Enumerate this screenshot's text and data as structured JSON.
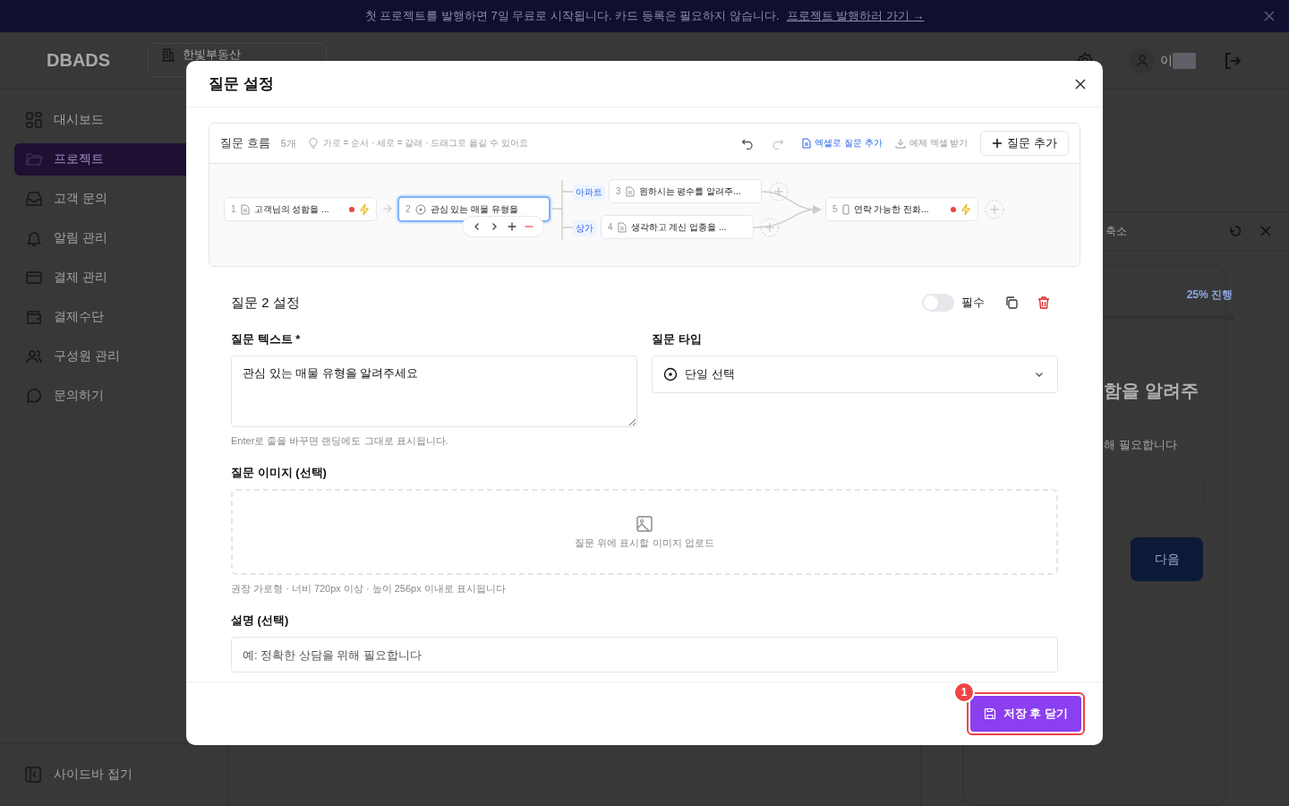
{
  "banner": {
    "text": "첫 프로젝트를 발행하면 7일 무료로 시작됩니다. 카드 등록은 필요하지 않습니다.",
    "link": "프로젝트 발행하러 가기 →"
  },
  "header": {
    "logo": "DBADS",
    "workspace": "한빛부동산",
    "user": "이"
  },
  "sidebar": {
    "items": [
      {
        "label": "대시보드",
        "selected": false
      },
      {
        "label": "프로젝트",
        "selected": true
      },
      {
        "label": "고객 문의",
        "selected": false
      },
      {
        "label": "알림 관리",
        "selected": false
      },
      {
        "label": "결제 관리",
        "selected": false
      },
      {
        "label": "결제수단",
        "selected": false
      },
      {
        "label": "구성원 관리",
        "selected": false
      },
      {
        "label": "문의하기",
        "selected": false
      }
    ],
    "collapse": "사이드바 접기"
  },
  "preview": {
    "shrink": "축소",
    "progress": "25% 진행",
    "heading": "함을 알려주",
    "subtext": "해 필요합니다",
    "next": "다음"
  },
  "modal": {
    "title": "질문 설정",
    "flow": {
      "title": "질문 흐름",
      "count": "5개",
      "hint": "가로 = 순서 · 세로 = 갈래 · 드래그로 옮길 수 있어요",
      "excel": "엑셀로 질문 추가",
      "sample": "예제 엑셀 받기",
      "add": "질문 추가",
      "nodes": [
        {
          "number": "1",
          "label": "고객님의 성함을 ...",
          "kind": "text",
          "selected": false,
          "required": true,
          "logic": true
        },
        {
          "number": "2",
          "label": "관심 있는 매물 유형을",
          "kind": "choice",
          "selected": true,
          "required": false,
          "logic": false
        },
        {
          "number": "3",
          "label": "원하시는 평수를 알려주...",
          "kind": "text",
          "selected": false,
          "required": false,
          "logic": false,
          "branch": "아파트"
        },
        {
          "number": "4",
          "label": "생각하고 계신 업종을 ...",
          "kind": "text",
          "selected": false,
          "required": false,
          "logic": false,
          "branch": "상가"
        },
        {
          "number": "5",
          "label": "연락 가능한 전화...",
          "kind": "phone",
          "selected": false,
          "required": true,
          "logic": true
        }
      ]
    },
    "settings": {
      "title": "질문 2 설정",
      "required_label": "필수",
      "required_on": false,
      "text_label": "질문 텍스트 *",
      "text_value": "관심 있는 매물 유형을 알려주세요",
      "text_help": "Enter로 줄을 바꾸면 랜딩에도 그대로 표시됩니다.",
      "type_label": "질문 타입",
      "type_value": "단일 선택",
      "image_label": "질문 이미지 (선택)",
      "upload": "질문 위에 표시할 이미지 업로드",
      "image_help": "권장 가로형 · 너비 720px 이상 · 높이 256px 이내로 표시됩니다",
      "desc_label": "설명 (선택)",
      "desc_placeholder": "예: 정확한 상담을 위해 필요합니다"
    },
    "save": "저장 후 닫기",
    "badge": "1"
  }
}
